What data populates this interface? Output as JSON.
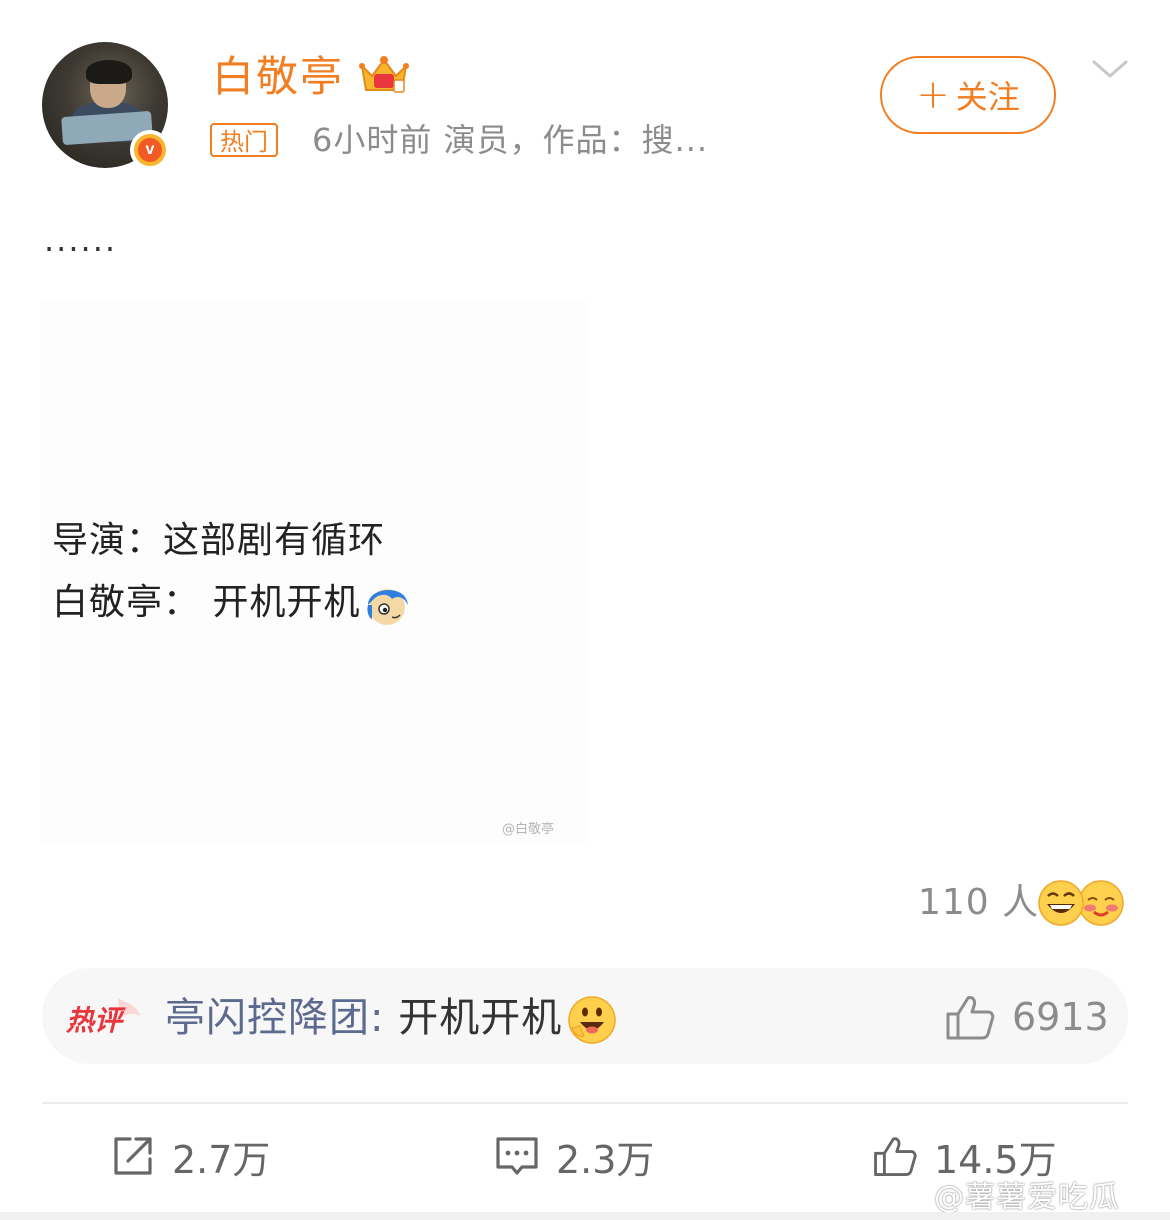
{
  "header": {
    "username": "白敬亭",
    "hot_tag": "热门",
    "meta": "6小时前  演员，作品：搜...",
    "follow_label": "关注",
    "icons": {
      "verified": "verified-v-badge-icon",
      "crown": "crown-member-icon",
      "more": "chevron-down-icon"
    }
  },
  "post": {
    "text": "......",
    "image": {
      "line1": "导演：这部剧有循环",
      "line2": "白敬亭：  开机开机",
      "watermark": "@白敬亭"
    }
  },
  "reactions": {
    "count": "110 人"
  },
  "hot_comment": {
    "label": "热评",
    "user": "亭闪控降团:",
    "text": " 开机开机",
    "likes": "6913"
  },
  "actions": {
    "repost": "2.7万",
    "comment": "2.3万",
    "like": "14.5万"
  },
  "watermark": "@薯薯爱吃瓜",
  "colors": {
    "accent": "#f37e21",
    "username_link": "#5d6a8f",
    "hot_label": "#e8363c"
  }
}
